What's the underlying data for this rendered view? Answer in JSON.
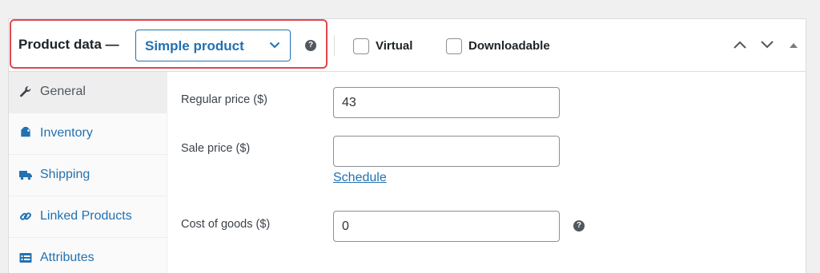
{
  "header": {
    "title": "Product data —",
    "product_type": "Simple product",
    "virtual_label": "Virtual",
    "downloadable_label": "Downloadable",
    "help_glyph": "?"
  },
  "tabs": [
    {
      "label": "General",
      "icon": "wrench-icon",
      "active": true
    },
    {
      "label": "Inventory",
      "icon": "tag-icon",
      "active": false
    },
    {
      "label": "Shipping",
      "icon": "truck-icon",
      "active": false
    },
    {
      "label": "Linked Products",
      "icon": "link-icon",
      "active": false
    },
    {
      "label": "Attributes",
      "icon": "list-icon",
      "active": false
    }
  ],
  "general": {
    "regular_price_label": "Regular price ($)",
    "regular_price_value": "43",
    "sale_price_label": "Sale price ($)",
    "sale_price_value": "",
    "schedule_link": "Schedule",
    "cost_label": "Cost of goods ($)",
    "cost_value": "0"
  },
  "colors": {
    "accent": "#2271b1",
    "highlight": "#e0474c",
    "text": "#1d2327"
  }
}
